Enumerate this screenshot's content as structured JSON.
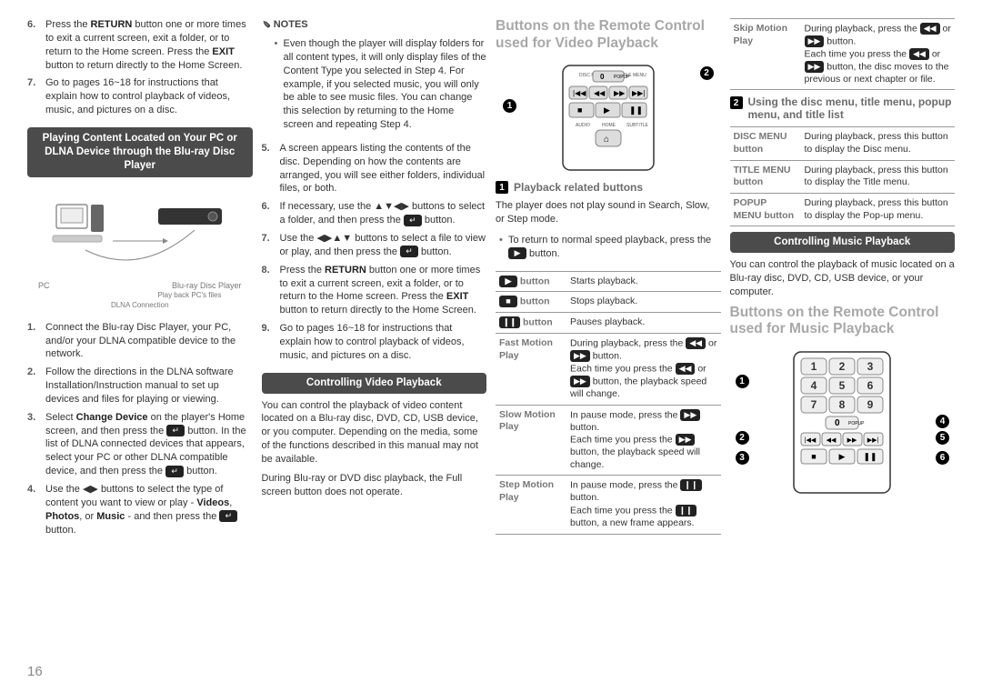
{
  "page_number": "16",
  "col1": {
    "list_start6": [
      "Press the <b>RETURN</b> button one or more times to exit a current screen, exit a folder, or to return to the Home screen. Press the <b>EXIT</b> button to return directly to the Home Screen.",
      "Go to pages 16~18 for instructions that explain how to control playback of videos, music, and pictures on a disc."
    ],
    "header1": "Playing Content Located on Your PC or DLNA Device through the Blu-ray Disc Player",
    "diagram_labels": {
      "pc": "PC",
      "player": "Blu-ray Disc Player",
      "arrow": "Play back PC's files",
      "conn": "DLNA Connection"
    },
    "list2": [
      "Connect the Blu-ray Disc Player, your PC, and/or your DLNA compatible device to the network.",
      "Follow the directions in the DLNA software Installation/Instruction manual to set up devices and files for playing or viewing.",
      "Select <b>Change Device</b> on the player's Home screen, and then press the <span class='icon'>&#8629;</span> button. In the list of DLNA connected devices that appears, select your PC or other DLNA compatible device, and then press the <span class='icon'>&#8629;</span> button.",
      "Use the &#9664;&#9654; buttons to select the type of content you want to view or play - <b>Videos</b>, <b>Photos</b>, or <b>Music</b> - and then press the <span class='icon'>&#8629;</span> button."
    ]
  },
  "col2": {
    "notes_label": "Notes",
    "note1": "Even though the player will display folders for all content types, it will only display files of the Content Type you selected in Step 4. For example, if you selected music, you will only be able to see music files. You can change this selection by returning to the Home screen and repeating Step 4.",
    "list_start5": [
      "A screen appears listing the contents of the disc. Depending on how the contents are arranged, you will see either folders, individual files, or both.",
      "If necessary, use the &#9650;&#9660;&#9664;&#9654; buttons to select a folder, and then press the <span class='icon'>&#8629;</span> button.",
      "Use the &#9664;&#9654;&#9650;&#9660; buttons to select a file to view or play, and then press the <span class='icon'>&#8629;</span> button.",
      "Press the <b>RETURN</b> button one or more times to exit a current screen, exit a folder, or to return to the Home screen. Press the <b>EXIT</b> button to return directly to the Home Screen.",
      "Go to pages 16~18 for instructions that explain how to control playback of videos, music, and pictures on a disc."
    ],
    "header2": "Controlling Video Playback",
    "intro2": "You can control the playback of video content located on a Blu-ray disc, DVD, CD, USB device, or you computer. Depending on the media, some of the functions described in this manual may not be available.",
    "intro2b": "During Blu-ray or DVD disc playback, the Full screen button does not operate."
  },
  "col3": {
    "title": "Buttons on the Remote Control used for Video Playback",
    "sub1": "Playback related buttons",
    "sub1_intro": "The player does not play sound in Search, Slow, or Step mode.",
    "sub1_bullet": "To return to normal speed playback, press the <span class='icon'>&#9654;</span> button.",
    "table1": [
      [
        "<span class='icon'>&#9654;</span> button",
        "Starts playback."
      ],
      [
        "<span class='icon'>&#9632;</span> button",
        "Stops playback."
      ],
      [
        "<span class='icon'>&#10073;&#10073;</span> button",
        "Pauses playback."
      ],
      [
        "Fast Motion Play",
        "During playback, press the <span class='icon'>&#9664;&#9664;</span> or <span class='icon'>&#9654;&#9654;</span> button.<br>Each time you press the <span class='icon'>&#9664;&#9664;</span> or <span class='icon'>&#9654;&#9654;</span> button, the playback speed will change."
      ],
      [
        "Slow Motion Play",
        "In pause mode, press the <span class='icon'>&#9654;&#9654;</span> button.<br>Each time you press the <span class='icon'>&#9654;&#9654;</span> button, the playback speed will change."
      ],
      [
        "Step Motion Play",
        "In pause mode, press the <span class='icon'>&#10073;&#10073;</span> button.<br>Each time you press the <span class='icon'>&#10073;&#10073;</span> button, a new frame appears."
      ]
    ]
  },
  "col4": {
    "row0": [
      "Skip Motion Play",
      "During playback, press the <span class='icon'>&#9664;&#9664;</span> or <span class='icon'>&#9654;&#9654;</span> button.<br>Each time you press the <span class='icon'>&#9664;&#9664;</span> or <span class='icon'>&#9654;&#9654;</span> button, the disc moves to the previous or next chapter or file."
    ],
    "sub2": "Using the disc menu, title menu, popup menu, and title list",
    "table2": [
      [
        "DISC MENU button",
        "During playback, press this button to display the Disc menu."
      ],
      [
        "TITLE MENU button",
        "During playback, press this button to display the Title menu."
      ],
      [
        "POPUP MENU button",
        "During playback, press this button to display the Pop-up menu."
      ]
    ],
    "header3": "Controlling Music Playback",
    "intro3": "You can control the playback of music located on a Blu-ray disc, DVD, CD, USB device, or your computer.",
    "title3": "Buttons on the Remote Control used for Music Playback"
  }
}
